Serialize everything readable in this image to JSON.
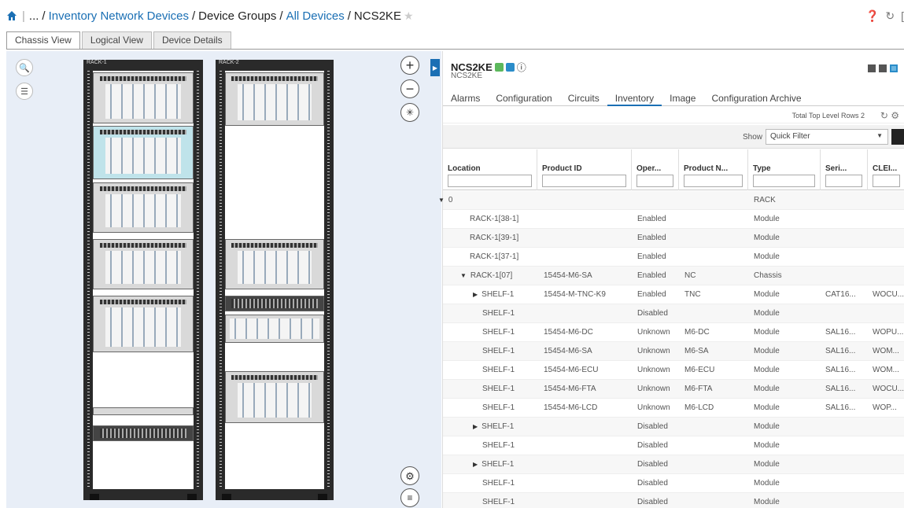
{
  "breadcrumb": {
    "ellipsis": "...",
    "inventory": "Inventory Network Devices",
    "groups": "Device Groups",
    "all": "All Devices",
    "device": "NCS2KE"
  },
  "tabs": [
    "Chassis View",
    "Logical View",
    "Device Details"
  ],
  "racks": [
    "RACK-1",
    "RACK-2"
  ],
  "device": {
    "name": "NCS2KE",
    "subtitle": "NCS2KE"
  },
  "subtabs": [
    "Alarms",
    "Configuration",
    "Circuits",
    "Inventory",
    "Image",
    "Configuration Archive"
  ],
  "info": {
    "total_rows": "Total Top Level Rows 2"
  },
  "filter": {
    "show_label": "Show",
    "quick_filter": "Quick Filter"
  },
  "columns": [
    "Location",
    "Product ID",
    "Oper...",
    "Product N...",
    "Type",
    "Seri...",
    "CLEI..."
  ],
  "rows": [
    {
      "indent": 0,
      "expand": "down",
      "location": "0",
      "product_id": "",
      "oper": "",
      "product_name": "",
      "type": "RACK",
      "serial": "",
      "clei": ""
    },
    {
      "indent": 1,
      "expand": "",
      "location": "RACK-1[38-1]",
      "product_id": "",
      "oper": "Enabled",
      "product_name": "",
      "type": "Module",
      "serial": "",
      "clei": ""
    },
    {
      "indent": 1,
      "expand": "",
      "location": "RACK-1[39-1]",
      "product_id": "",
      "oper": "Enabled",
      "product_name": "",
      "type": "Module",
      "serial": "",
      "clei": ""
    },
    {
      "indent": 1,
      "expand": "",
      "location": "RACK-1[37-1]",
      "product_id": "",
      "oper": "Enabled",
      "product_name": "",
      "type": "Module",
      "serial": "",
      "clei": ""
    },
    {
      "indent": 1,
      "expand": "down",
      "location": "RACK-1[07]",
      "product_id": "15454-M6-SA",
      "oper": "Enabled",
      "product_name": "NC",
      "type": "Chassis",
      "serial": "",
      "clei": ""
    },
    {
      "indent": 2,
      "expand": "right",
      "location": "SHELF-1",
      "product_id": "15454-M-TNC-K9",
      "oper": "Enabled",
      "product_name": "TNC",
      "type": "Module",
      "serial": "CAT16...",
      "clei": "WOCU..."
    },
    {
      "indent": 2,
      "expand": "",
      "location": "SHELF-1",
      "product_id": "",
      "oper": "Disabled",
      "product_name": "",
      "type": "Module",
      "serial": "",
      "clei": ""
    },
    {
      "indent": 2,
      "expand": "",
      "location": "SHELF-1",
      "product_id": "15454-M6-DC",
      "oper": "Unknown",
      "product_name": "M6-DC",
      "type": "Module",
      "serial": "SAL16...",
      "clei": "WOPU..."
    },
    {
      "indent": 2,
      "expand": "",
      "location": "SHELF-1",
      "product_id": "15454-M6-SA",
      "oper": "Unknown",
      "product_name": "M6-SA",
      "type": "Module",
      "serial": "SAL16...",
      "clei": "WOM..."
    },
    {
      "indent": 2,
      "expand": "",
      "location": "SHELF-1",
      "product_id": "15454-M6-ECU",
      "oper": "Unknown",
      "product_name": "M6-ECU",
      "type": "Module",
      "serial": "SAL16...",
      "clei": "WOM..."
    },
    {
      "indent": 2,
      "expand": "",
      "location": "SHELF-1",
      "product_id": "15454-M6-FTA",
      "oper": "Unknown",
      "product_name": "M6-FTA",
      "type": "Module",
      "serial": "SAL16...",
      "clei": "WOCU..."
    },
    {
      "indent": 2,
      "expand": "",
      "location": "SHELF-1",
      "product_id": "15454-M6-LCD",
      "oper": "Unknown",
      "product_name": "M6-LCD",
      "type": "Module",
      "serial": "SAL16...",
      "clei": "WOP..."
    },
    {
      "indent": 2,
      "expand": "right",
      "location": "SHELF-1",
      "product_id": "",
      "oper": "Disabled",
      "product_name": "",
      "type": "Module",
      "serial": "",
      "clei": ""
    },
    {
      "indent": 2,
      "expand": "",
      "location": "SHELF-1",
      "product_id": "",
      "oper": "Disabled",
      "product_name": "",
      "type": "Module",
      "serial": "",
      "clei": ""
    },
    {
      "indent": 2,
      "expand": "right",
      "location": "SHELF-1",
      "product_id": "",
      "oper": "Disabled",
      "product_name": "",
      "type": "Module",
      "serial": "",
      "clei": ""
    },
    {
      "indent": 2,
      "expand": "",
      "location": "SHELF-1",
      "product_id": "",
      "oper": "Disabled",
      "product_name": "",
      "type": "Module",
      "serial": "",
      "clei": ""
    },
    {
      "indent": 2,
      "expand": "",
      "location": "SHELF-1",
      "product_id": "",
      "oper": "Disabled",
      "product_name": "",
      "type": "Module",
      "serial": "",
      "clei": ""
    }
  ],
  "colors": {
    "link": "#1a6fb4",
    "badge_green": "#5cb85c",
    "badge_blue": "#2a8cc9",
    "chassis_bg": "#e8eef7",
    "rack": "#2a2a2a"
  },
  "icons": [
    "home-icon",
    "star-icon",
    "help-icon",
    "refresh-icon",
    "zoom-icon",
    "legend-icon",
    "zoom-in-icon",
    "zoom-out-icon",
    "fit-icon",
    "settings-icon",
    "menu-icon",
    "collapse-arrow-icon",
    "reachable-badge-icon",
    "sync-badge-icon",
    "info-icon",
    "gear-icon",
    "filter-icon"
  ]
}
